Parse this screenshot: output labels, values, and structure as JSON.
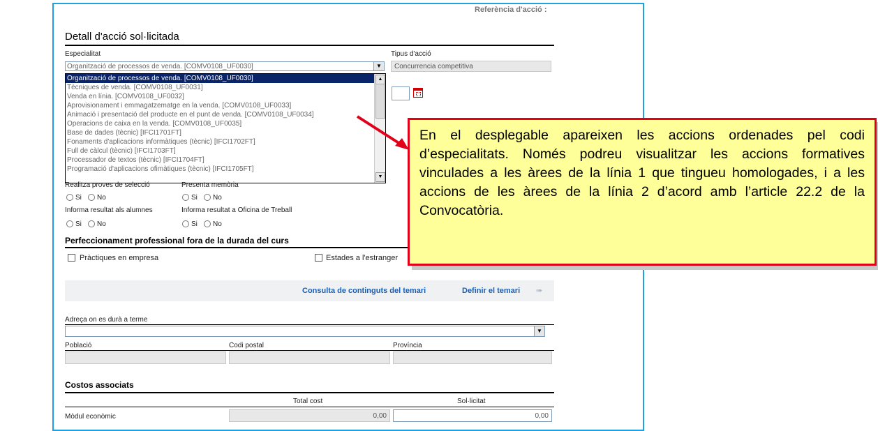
{
  "reference_label": "Referència d'acció :",
  "section_title": "Detall d'acció sol·licitada",
  "especialitat": {
    "label": "Especialitat",
    "selected": "Organització de processos de venda. [COMV0108_UF0030]"
  },
  "tipus_accio": {
    "label": "Tipus d'acció",
    "value": "Concurrencia competitiva"
  },
  "dropdown_options": [
    "Organització de processos de venda. [COMV0108_UF0030]",
    "Tècniques de venda. [COMV0108_UF0031]",
    "Venda en línia. [COMV0108_UF0032]",
    "Aprovisionament i emmagatzematge en la venda. [COMV0108_UF0033]",
    "Animació i presentació del producte en el punt de venda. [COMV0108_UF0034]",
    "Operacions de caixa en la venda. [COMV0108_UF0035]",
    "Base de dades (tècnic) [IFCI1701FT]",
    "Fonaments d'aplicacions informàtiques (tècnic) [IFCI1702FT]",
    "Full de càlcul (tècnic) [IFCI1703FT]",
    "Processador de textos (tècnic) [IFCI1704FT]",
    "Programació d'aplicacions ofimàtiques (tècnic) [IFCI1705FT]"
  ],
  "questions": {
    "proves_seleccio": "Realitza proves de selecció",
    "presenta_memoria": "Presenta memòria",
    "informa_alumnes": "Informa resultat als alumnes",
    "informa_oficina": "Informa resultat a Oficina de Treball",
    "si": "Si",
    "no": "No"
  },
  "perfeccionament": {
    "title": "Perfeccionament professional fora de la durada del curs",
    "practiques": "Pràctiques en empresa",
    "estades": "Estades a l'estranger"
  },
  "links": {
    "consulta": "Consulta de continguts del temari",
    "definir": "Definir el temari"
  },
  "adreca_label": "Adreça on es durà a terme",
  "poblacio_label": "Població",
  "codi_postal_label": "Codi postal",
  "provincia_label": "Província",
  "costos": {
    "title": "Costos associats",
    "total_cost": "Total cost",
    "sollicitat": "Sol·licitat",
    "modul": "Mòdul econòmic",
    "total_value": "0,00",
    "sollicitat_value": "0,00"
  },
  "callout_text": "En el desplegable apareixen les accions ordenades pel codi d’especialitats. Només podreu visualitzar les accions formatives vinculades a les àrees de la línia 1 que tingueu homologades, i a les accions de les àrees de la línia 2 d’acord amb l’article 22.2 de la Convocatòria.",
  "colors": {
    "frame_border": "#1ea1e0",
    "highlight": "#0a246a",
    "callout_bg": "#ffff99",
    "callout_border": "#e0001a",
    "link": "#1a5fb4"
  }
}
